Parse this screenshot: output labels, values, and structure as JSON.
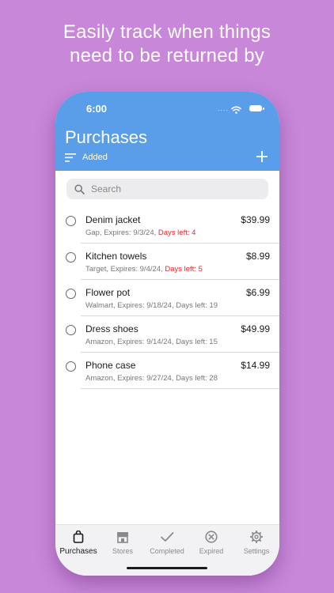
{
  "headline": {
    "line1": "Easily track when things",
    "line2": "need to be returned by"
  },
  "status_bar": {
    "time": "6:00",
    "signal": "...."
  },
  "header": {
    "title": "Purchases",
    "sort_label": "Added"
  },
  "search": {
    "placeholder": "Search"
  },
  "items": [
    {
      "name": "Denim jacket",
      "price": "$39.99",
      "detail": "Gap, Expires: 9/3/24,",
      "days_left": "Days left: 4",
      "urgent": true
    },
    {
      "name": "Kitchen towels",
      "price": "$8.99",
      "detail": "Target, Expires: 9/4/24,",
      "days_left": "Days left: 5",
      "urgent": true
    },
    {
      "name": "Flower pot",
      "price": "$6.99",
      "detail": "Walmart, Expires: 9/18/24,",
      "days_left": "Days left: 19",
      "urgent": false
    },
    {
      "name": "Dress shoes",
      "price": "$49.99",
      "detail": "Amazon, Expires: 9/14/24,",
      "days_left": "Days left: 15",
      "urgent": false
    },
    {
      "name": "Phone case",
      "price": "$14.99",
      "detail": "Amazon, Expires: 9/27/24,",
      "days_left": "Days left: 28",
      "urgent": false
    }
  ],
  "tabs": [
    {
      "label": "Purchases",
      "icon": "bag-icon",
      "active": true
    },
    {
      "label": "Stores",
      "icon": "store-icon",
      "active": false
    },
    {
      "label": "Completed",
      "icon": "checkmark-icon",
      "active": false
    },
    {
      "label": "Expired",
      "icon": "x-circle-icon",
      "active": false
    },
    {
      "label": "Settings",
      "icon": "gear-icon",
      "active": false
    }
  ],
  "colors": {
    "background": "#c887d8",
    "appbar": "#5a9de8",
    "urgent": "#e02a2a"
  }
}
